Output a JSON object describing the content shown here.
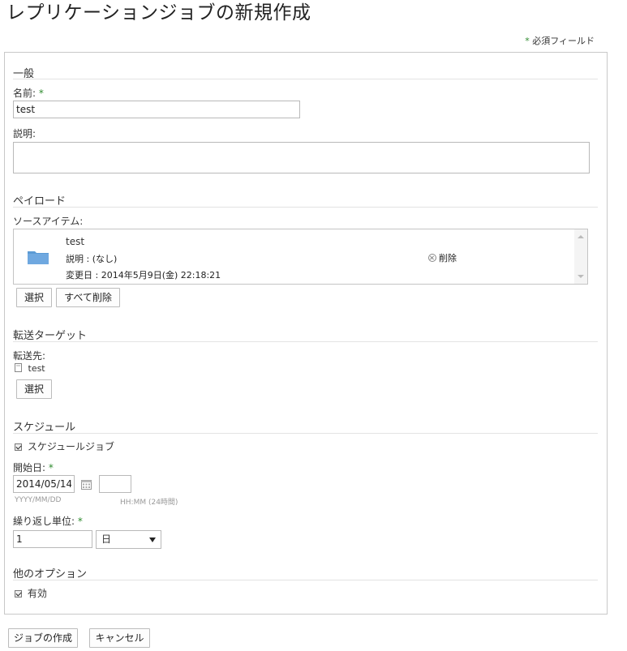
{
  "page": {
    "title": "レプリケーションジョブの新規作成"
  },
  "required_note": {
    "star": "*",
    "text": "必須フィールド"
  },
  "general": {
    "section_title": "一般",
    "name_label": "名前:",
    "name_value": "test",
    "description_label": "説明:",
    "description_value": ""
  },
  "payload": {
    "section_title": "ペイロード",
    "source_items_label": "ソースアイテム:",
    "item": {
      "name": "test",
      "description": "説明 : (なし)",
      "modified": "変更日 : 2014年5月9日(金) 22:18:21",
      "remove_label": "削除",
      "icon": "folder-icon"
    },
    "select_button": "選択",
    "remove_all_button": "すべて削除"
  },
  "transfer_target": {
    "section_title": "転送ターゲット",
    "destination_label": "転送先:",
    "destination_value": "test",
    "select_button": "選択"
  },
  "schedule": {
    "section_title": "スケジュール",
    "schedule_job_label": "スケジュールジョブ",
    "schedule_job_checked": true,
    "start_date_label": "開始日:",
    "start_date_value": "2014/05/14",
    "date_hint": "YYYY/MM/DD",
    "time_value": "",
    "time_hint": "HH:MM (24時間)",
    "repeat_label": "繰り返し単位:",
    "repeat_value": "1",
    "repeat_unit": "日"
  },
  "other_options": {
    "section_title": "他のオプション",
    "enabled_label": "有効",
    "enabled_checked": true
  },
  "footer": {
    "create_button": "ジョブの作成",
    "cancel_button": "キャンセル"
  },
  "colors": {
    "required_star": "#2e8b2e",
    "folder": "#5b9bd5"
  }
}
